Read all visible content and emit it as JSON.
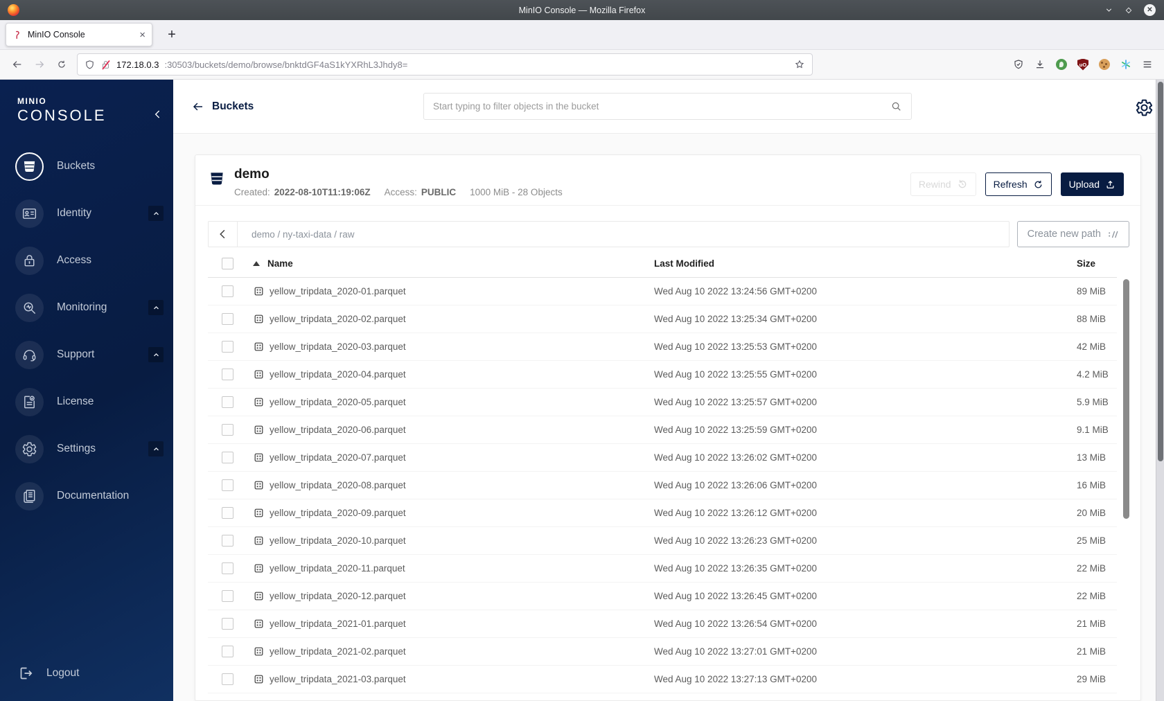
{
  "browser": {
    "window_title": "MinIO Console — Mozilla Firefox",
    "tab_title": "MinIO Console",
    "tab_close_glyph": "×",
    "new_tab_glyph": "+",
    "url": {
      "host": "172.18.0.3",
      "rest": ":30503/buckets/demo/browse/bnktdGF4aS1kYXRhL3Jhdy8="
    }
  },
  "sidebar": {
    "logo_line1": "MINIO",
    "logo_line2": "CONSOLE",
    "items": [
      {
        "label": "Buckets",
        "icon": "bucket",
        "selected": true,
        "expandable": false
      },
      {
        "label": "Identity",
        "icon": "idcard",
        "selected": false,
        "expandable": true
      },
      {
        "label": "Access",
        "icon": "lock",
        "selected": false,
        "expandable": false
      },
      {
        "label": "Monitoring",
        "icon": "monitor",
        "selected": false,
        "expandable": true
      },
      {
        "label": "Support",
        "icon": "support",
        "selected": false,
        "expandable": true
      },
      {
        "label": "License",
        "icon": "license",
        "selected": false,
        "expandable": false
      },
      {
        "label": "Settings",
        "icon": "gear",
        "selected": false,
        "expandable": true
      },
      {
        "label": "Documentation",
        "icon": "book",
        "selected": false,
        "expandable": false
      }
    ],
    "logout_label": "Logout"
  },
  "topbar": {
    "back_label": "Buckets",
    "search_placeholder": "Start typing to filter objects in the bucket"
  },
  "bucket": {
    "name": "demo",
    "created_label": "Created:",
    "created_value": "2022-08-10T11:19:06Z",
    "access_label": "Access:",
    "access_value": "PUBLIC",
    "summary": "1000 MiB - 28 Objects",
    "rewind_label": "Rewind",
    "refresh_label": "Refresh",
    "upload_label": "Upload"
  },
  "breadcrumb": {
    "path": "demo / ny-taxi-data / raw",
    "create_label": "Create new path"
  },
  "table": {
    "col_name": "Name",
    "col_modified": "Last Modified",
    "col_size": "Size",
    "rows": [
      {
        "name": "yellow_tripdata_2020-01.parquet",
        "modified": "Wed Aug 10 2022 13:24:56 GMT+0200",
        "size": "89 MiB"
      },
      {
        "name": "yellow_tripdata_2020-02.parquet",
        "modified": "Wed Aug 10 2022 13:25:34 GMT+0200",
        "size": "88 MiB"
      },
      {
        "name": "yellow_tripdata_2020-03.parquet",
        "modified": "Wed Aug 10 2022 13:25:53 GMT+0200",
        "size": "42 MiB"
      },
      {
        "name": "yellow_tripdata_2020-04.parquet",
        "modified": "Wed Aug 10 2022 13:25:55 GMT+0200",
        "size": "4.2 MiB"
      },
      {
        "name": "yellow_tripdata_2020-05.parquet",
        "modified": "Wed Aug 10 2022 13:25:57 GMT+0200",
        "size": "5.9 MiB"
      },
      {
        "name": "yellow_tripdata_2020-06.parquet",
        "modified": "Wed Aug 10 2022 13:25:59 GMT+0200",
        "size": "9.1 MiB"
      },
      {
        "name": "yellow_tripdata_2020-07.parquet",
        "modified": "Wed Aug 10 2022 13:26:02 GMT+0200",
        "size": "13 MiB"
      },
      {
        "name": "yellow_tripdata_2020-08.parquet",
        "modified": "Wed Aug 10 2022 13:26:06 GMT+0200",
        "size": "16 MiB"
      },
      {
        "name": "yellow_tripdata_2020-09.parquet",
        "modified": "Wed Aug 10 2022 13:26:12 GMT+0200",
        "size": "20 MiB"
      },
      {
        "name": "yellow_tripdata_2020-10.parquet",
        "modified": "Wed Aug 10 2022 13:26:23 GMT+0200",
        "size": "25 MiB"
      },
      {
        "name": "yellow_tripdata_2020-11.parquet",
        "modified": "Wed Aug 10 2022 13:26:35 GMT+0200",
        "size": "22 MiB"
      },
      {
        "name": "yellow_tripdata_2020-12.parquet",
        "modified": "Wed Aug 10 2022 13:26:45 GMT+0200",
        "size": "22 MiB"
      },
      {
        "name": "yellow_tripdata_2021-01.parquet",
        "modified": "Wed Aug 10 2022 13:26:54 GMT+0200",
        "size": "21 MiB"
      },
      {
        "name": "yellow_tripdata_2021-02.parquet",
        "modified": "Wed Aug 10 2022 13:27:01 GMT+0200",
        "size": "21 MiB"
      },
      {
        "name": "yellow_tripdata_2021-03.parquet",
        "modified": "Wed Aug 10 2022 13:27:13 GMT+0200",
        "size": "29 MiB"
      }
    ]
  },
  "colors": {
    "brand_navy": "#081C42",
    "favicon_red": "#C72C48",
    "ublock_red": "#7F1416"
  }
}
